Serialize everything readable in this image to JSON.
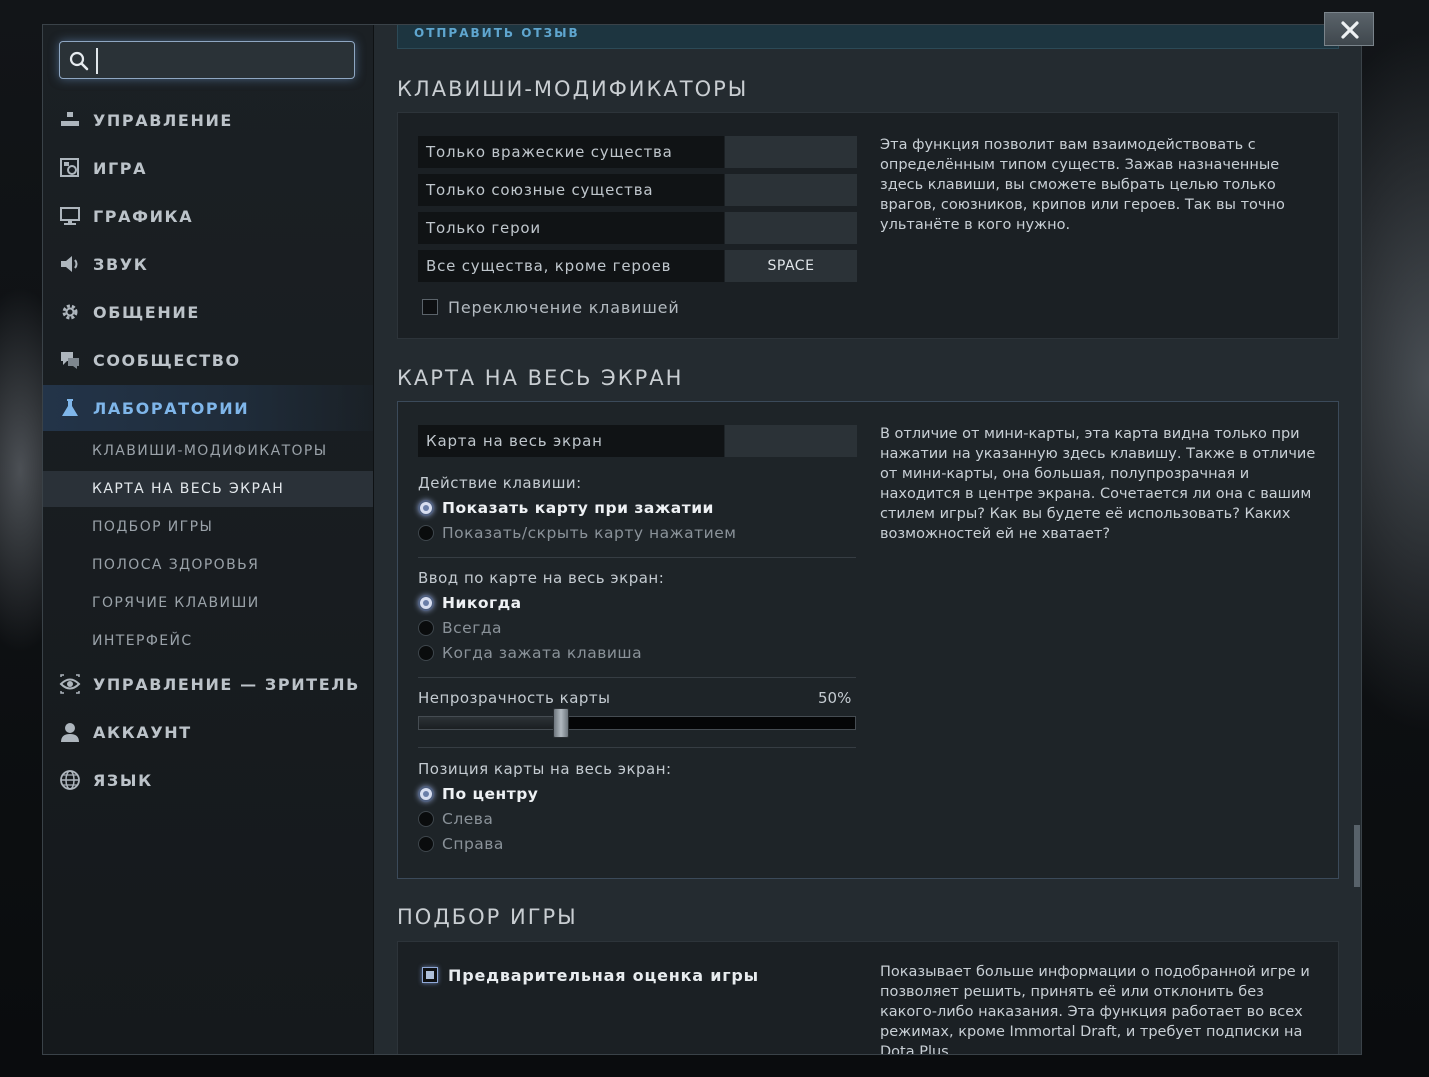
{
  "search": {
    "value": "",
    "placeholder": ""
  },
  "sidebar": {
    "items": [
      {
        "key": "controls",
        "label": "УПРАВЛЕНИЕ",
        "icon": "hierarchy-icon"
      },
      {
        "key": "game",
        "label": "ИГРА",
        "icon": "game-settings-icon"
      },
      {
        "key": "graphics",
        "label": "ГРАФИКА",
        "icon": "monitor-icon"
      },
      {
        "key": "sound",
        "label": "ЗВУК",
        "icon": "speaker-icon"
      },
      {
        "key": "social",
        "label": "ОБЩЕНИЕ",
        "icon": "gear-icon"
      },
      {
        "key": "community",
        "label": "СООБЩЕСТВО",
        "icon": "chat-bubbles-icon"
      },
      {
        "key": "labs",
        "label": "ЛАБОРАТОРИИ",
        "icon": "flask-icon"
      },
      {
        "key": "spectator",
        "label": "УПРАВЛЕНИЕ — ЗРИТЕЛЬ",
        "icon": "spectator-eye-icon"
      },
      {
        "key": "account",
        "label": "АККАУНТ",
        "icon": "user-icon"
      },
      {
        "key": "language",
        "label": "ЯЗЫК",
        "icon": "globe-icon"
      }
    ],
    "sub_items": [
      "КЛАВИШИ-МОДИФИКАТОРЫ",
      "КАРТА НА ВЕСЬ ЭКРАН",
      "ПОДБОР ИГРЫ",
      "ПОЛОСА ЗДОРОВЬЯ",
      "ГОРЯЧИЕ КЛАВИШИ",
      "ИНТЕРФЕЙС"
    ]
  },
  "feedback": {
    "label": "ОТПРАВИТЬ ОТЗЫВ"
  },
  "modifiers": {
    "title": "КЛАВИШИ-МОДИФИКАТОРЫ",
    "rows": [
      {
        "label": "Только вражеские существа",
        "key": ""
      },
      {
        "label": "Только союзные существа",
        "key": ""
      },
      {
        "label": "Только герои",
        "key": ""
      },
      {
        "label": "Все существа, кроме героев",
        "key": "SPACE"
      }
    ],
    "toggle_label": "Переключение клавишей",
    "toggle_checked": false,
    "description": "Эта функция позволит вам взаимодействовать с определённым типом существ. Зажав назначенные здесь клавиши, вы сможете выбрать целью только врагов, союзников, крипов или героев. Так вы точно ультанёте в кого нужно."
  },
  "fullmap": {
    "title": "КАРТА НА ВЕСЬ ЭКРАН",
    "bind_label": "Карта на весь экран",
    "bind_key": "",
    "action_label": "Действие клавиши:",
    "action_options": [
      "Показать карту при зажатии",
      "Показать/скрыть карту нажатием"
    ],
    "action_selected": 0,
    "input_label": "Ввод по карте на весь экран:",
    "input_options": [
      "Никогда",
      "Всегда",
      "Когда зажата клавиша"
    ],
    "input_selected": 0,
    "opacity_label": "Непрозрачность карты",
    "opacity_value": 50,
    "opacity_text": "50%",
    "position_label": "Позиция карты на весь экран:",
    "position_options": [
      "По центру",
      "Слева",
      "Справа"
    ],
    "position_selected": 0,
    "description": "В отличие от мини-карты, эта карта видна только при нажатии на указанную здесь клавишу. Также в отличие от мини-карты, она большая, полупрозрачная и находится в центре экрана. Сочетается ли она с вашим стилем игры? Как вы будете её использовать? Каких возможностей ей не хватает?"
  },
  "matchmaking": {
    "title": "ПОДБОР ИГРЫ",
    "toggle_label": "Предварительная оценка игры",
    "toggle_checked": true,
    "description": "Показывает больше информации о подобранной игре и позволяет решить, принять её или отклонить без какого-либо наказания. Эта функция работает во всех режимах, кроме Immortal Draft, и требует подписки на Dota Plus."
  },
  "colors": {
    "accent": "#7fb6ea",
    "panel": "#1b2024",
    "window": "#242b30"
  }
}
